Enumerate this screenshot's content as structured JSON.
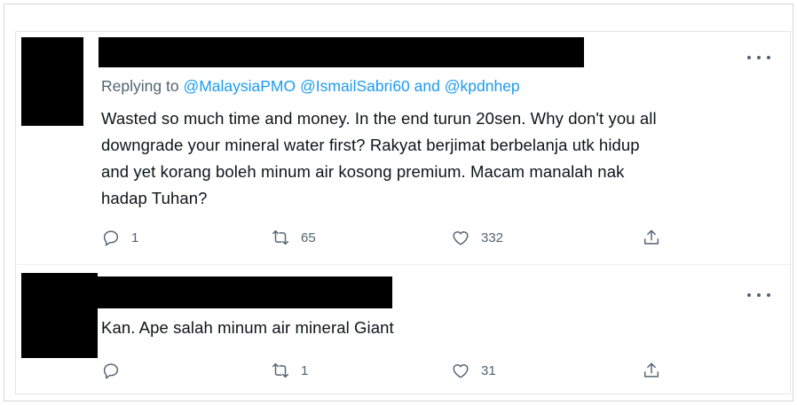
{
  "tweets": [
    {
      "replying_prefix": "Replying to",
      "handles": [
        "@MalaysiaPMO",
        "@IsmailSabri60"
      ],
      "handle_join": "and",
      "handle_last": "@kpdnhep",
      "lines": [
        "Wasted so much time and money. In the end turun 20sen. Why don't you all",
        "downgrade your mineral water first? Rakyat berjimat berbelanja utk hidup",
        "and yet korang boleh minum air kosong premium. Macam manalah nak",
        "hadap Tuhan?"
      ],
      "replies": "1",
      "retweets": "65",
      "likes": "332"
    },
    {
      "lines": [
        "Kan. Ape salah minum air mineral Giant"
      ],
      "replies": "",
      "retweets": "1",
      "likes": "31"
    }
  ],
  "icons": {
    "more": "more-horizontal-icon",
    "reply": "reply-icon",
    "retweet": "retweet-icon",
    "like": "heart-icon",
    "share": "share-icon"
  },
  "colors": {
    "link": "#1d9bf0",
    "muted": "#536471",
    "text": "#0f1419",
    "redaction": "#000000"
  }
}
